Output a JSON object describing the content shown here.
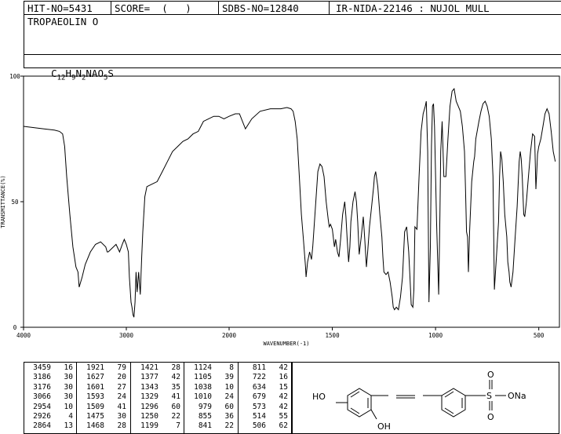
{
  "header": {
    "hit_no": "HIT-NO=5431",
    "score": "SCORE=  (   )",
    "sdbs_no": "SDBS-NO=12840",
    "ir_code": "IR-NIDA-22146 : NUJOL MULL",
    "compound_name": "TROPAEOLIN O",
    "formula_parts": [
      "C",
      "12",
      "H",
      "9",
      "N",
      "2",
      "NAO",
      "5",
      "S"
    ]
  },
  "chart_data": {
    "type": "line",
    "xlabel": "WAVENUMBER(-1)",
    "ylabel": "TRANSMITTANCE(%)",
    "xlim": [
      4000,
      400
    ],
    "ylim": [
      0,
      100
    ],
    "x_ticks": [
      "4000",
      "3000",
      "2000",
      "1500",
      "1000",
      "500"
    ],
    "y_ticks": [
      "100",
      "50",
      "0"
    ],
    "grid": false,
    "spectrum": {
      "x": [
        4000,
        3900,
        3800,
        3700,
        3650,
        3620,
        3600,
        3580,
        3550,
        3520,
        3490,
        3470,
        3459,
        3430,
        3400,
        3350,
        3300,
        3250,
        3200,
        3186,
        3176,
        3150,
        3100,
        3066,
        3040,
        3020,
        3000,
        2980,
        2970,
        2954,
        2945,
        2935,
        2926,
        2915,
        2905,
        2895,
        2880,
        2864,
        2850,
        2840,
        2820,
        2800,
        2750,
        2700,
        2650,
        2600,
        2550,
        2500,
        2450,
        2400,
        2350,
        2300,
        2250,
        2200,
        2150,
        2100,
        2050,
        2000,
        1970,
        1950,
        1921,
        1890,
        1850,
        1800,
        1750,
        1720,
        1700,
        1690,
        1680,
        1670,
        1660,
        1650,
        1640,
        1630,
        1627,
        1620,
        1610,
        1601,
        1595,
        1590,
        1580,
        1570,
        1560,
        1550,
        1540,
        1530,
        1520,
        1515,
        1509,
        1500,
        1490,
        1484,
        1475,
        1468,
        1460,
        1450,
        1440,
        1434,
        1428,
        1421,
        1415,
        1410,
        1400,
        1390,
        1383,
        1377,
        1370,
        1360,
        1350,
        1343,
        1335,
        1329,
        1320,
        1310,
        1300,
        1296,
        1290,
        1280,
        1270,
        1260,
        1255,
        1250,
        1240,
        1230,
        1220,
        1210,
        1205,
        1199,
        1190,
        1180,
        1170,
        1160,
        1150,
        1140,
        1130,
        1124,
        1118,
        1110,
        1105,
        1100,
        1090,
        1080,
        1070,
        1060,
        1050,
        1045,
        1038,
        1032,
        1025,
        1020,
        1015,
        1010,
        1005,
        995,
        985,
        979,
        975,
        968,
        960,
        950,
        940,
        930,
        920,
        910,
        900,
        890,
        880,
        870,
        860,
        855,
        850,
        845,
        841,
        835,
        825,
        815,
        811,
        805,
        790,
        780,
        770,
        760,
        750,
        740,
        730,
        722,
        715,
        705,
        695,
        690,
        685,
        679,
        672,
        665,
        655,
        650,
        644,
        640,
        634,
        625,
        615,
        605,
        595,
        590,
        585,
        580,
        573,
        568,
        560,
        550,
        540,
        530,
        520,
        514,
        510,
        506,
        500,
        490,
        480,
        470,
        460,
        450,
        440,
        430,
        420,
        410,
        400
      ],
      "y": [
        80,
        79.5,
        79,
        78.5,
        78,
        77,
        72,
        60,
        45,
        32,
        24,
        22,
        16,
        20,
        25,
        30,
        33,
        34,
        32,
        30,
        30,
        31,
        33,
        30,
        33,
        35,
        33,
        30,
        20,
        10,
        8,
        5,
        4,
        10,
        22,
        14,
        22,
        13,
        28,
        38,
        52,
        56,
        57,
        58,
        62,
        66,
        70,
        72,
        74,
        75,
        77,
        78,
        82,
        83,
        84,
        84,
        83,
        84,
        85,
        85,
        79,
        83,
        86,
        87,
        87,
        87.5,
        87,
        86,
        82,
        75,
        60,
        45,
        35,
        24,
        20,
        26,
        30,
        27,
        32,
        38,
        50,
        62,
        65,
        64,
        60,
        50,
        43,
        40,
        41,
        39,
        32,
        35,
        30,
        28,
        35,
        45,
        50,
        44,
        35,
        26,
        32,
        42,
        50,
        54,
        50,
        42,
        29,
        36,
        44,
        35,
        24,
        30,
        40,
        48,
        56,
        60,
        62,
        56,
        45,
        36,
        28,
        22,
        21,
        22,
        18,
        12,
        8,
        7,
        8,
        7,
        12,
        20,
        38,
        40,
        30,
        20,
        9,
        8,
        15,
        40,
        39,
        60,
        78,
        85,
        88,
        90,
        70,
        10,
        32,
        72,
        88,
        89,
        80,
        42,
        13,
        45,
        70,
        82,
        60,
        60,
        75,
        88,
        94,
        95,
        90,
        88,
        86,
        80,
        70,
        55,
        38,
        36,
        22,
        38,
        58,
        66,
        68,
        75,
        82,
        86,
        89,
        90,
        88,
        84,
        75,
        60,
        15,
        28,
        42,
        60,
        70,
        67,
        58,
        45,
        36,
        26,
        22,
        18,
        16,
        22,
        35,
        48,
        66,
        70,
        67,
        60,
        45,
        44,
        50,
        60,
        70,
        77,
        76,
        55,
        62,
        69,
        72,
        75,
        80,
        85,
        87,
        85,
        78,
        70,
        66
      ]
    },
    "peak_columns": [
      {
        "wavenumbers": [
          "3459",
          "3186",
          "3176",
          "3066",
          "2954",
          "2926",
          "2864"
        ],
        "transmittance": [
          "16",
          "30",
          "30",
          "30",
          "10",
          "4",
          "13"
        ]
      },
      {
        "wavenumbers": [
          "1921",
          "1627",
          "1601",
          "1593",
          "1509",
          "1475",
          "1468"
        ],
        "transmittance": [
          "79",
          "20",
          "27",
          "24",
          "41",
          "30",
          "28"
        ]
      },
      {
        "wavenumbers": [
          "1421",
          "1377",
          "1343",
          "1329",
          "1296",
          "1250",
          "1199"
        ],
        "transmittance": [
          "28",
          "42",
          "35",
          "41",
          "60",
          "22",
          "7"
        ]
      },
      {
        "wavenumbers": [
          "1124",
          "1105",
          "1038",
          "1010",
          "979",
          "855",
          "841"
        ],
        "transmittance": [
          "8",
          "39",
          "10",
          "24",
          "60",
          "36",
          "22"
        ]
      },
      {
        "wavenumbers": [
          "811",
          "722",
          "634",
          "679",
          "573",
          "514",
          "506"
        ],
        "transmittance": [
          "42",
          "16",
          "15",
          "42",
          "42",
          "55",
          "62"
        ]
      }
    ],
    "structure_labels": {
      "ho": "HO",
      "oh": "OH",
      "o_top": "O",
      "o_bottom": "O",
      "s": "S",
      "ona": "ONa"
    }
  }
}
